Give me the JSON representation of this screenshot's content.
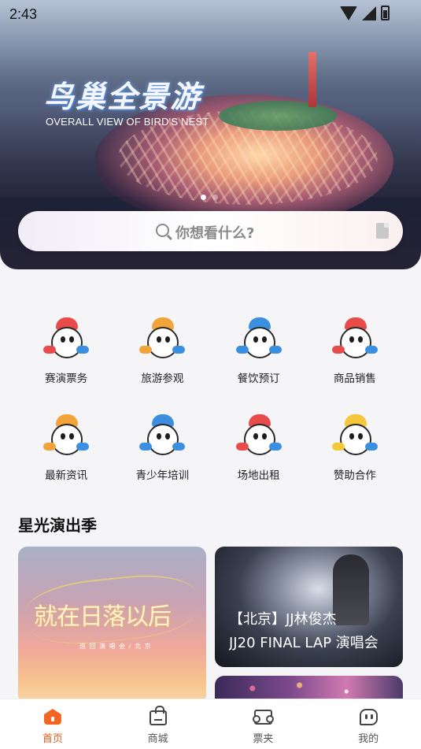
{
  "status_bar": {
    "time": "2:43"
  },
  "banner": {
    "title_cn": "鸟巢全景游",
    "title_en": "OVERALL VIEW OF BIRD'S NEST",
    "page_count": 2,
    "active_page": 1
  },
  "search": {
    "placeholder": "你想看什么?"
  },
  "services": [
    {
      "label": "赛演票务",
      "icon": "mascot-ticket-icon",
      "color": "#e94b4b"
    },
    {
      "label": "旅游参观",
      "icon": "mascot-tour-icon",
      "color": "#f2a33a"
    },
    {
      "label": "餐饮预订",
      "icon": "mascot-dining-icon",
      "color": "#3b8fe0"
    },
    {
      "label": "商品销售",
      "icon": "mascot-shop-icon",
      "color": "#e94b4b"
    },
    {
      "label": "最新资讯",
      "icon": "mascot-news-icon",
      "color": "#f2a33a"
    },
    {
      "label": "青少年培训",
      "icon": "mascot-training-icon",
      "color": "#3b8fe0"
    },
    {
      "label": "场地出租",
      "icon": "mascot-rental-icon",
      "color": "#e94b4b"
    },
    {
      "label": "赞助合作",
      "icon": "mascot-sponsor-icon",
      "color": "#f5c73a"
    }
  ],
  "section": {
    "title": "星光演出季",
    "cards": [
      {
        "poster_title": "就在日落以后",
        "poster_sub": "巡 回 演 唱 会 / 北 京"
      },
      {
        "caption_line1": "【北京】JJ林俊杰",
        "caption_line2": "JJ20 FINAL LAP 演唱会"
      }
    ]
  },
  "tabbar": {
    "tabs": [
      {
        "label": "首页",
        "icon": "home-icon",
        "active": true
      },
      {
        "label": "商城",
        "icon": "shopping-bag-icon",
        "active": false
      },
      {
        "label": "票夹",
        "icon": "ticket-icon",
        "active": false
      },
      {
        "label": "我的",
        "icon": "profile-icon",
        "active": false
      }
    ]
  },
  "colors": {
    "accent": "#f26522",
    "background": "#f5f5f7"
  }
}
